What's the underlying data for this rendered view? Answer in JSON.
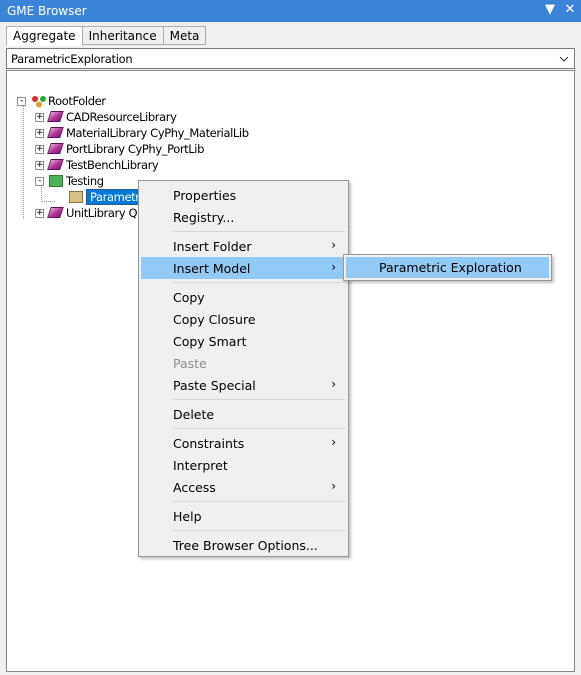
{
  "window": {
    "title": "GME Browser",
    "dropdown_icon": "dropdown-triangle-icon",
    "close_icon": "close-icon"
  },
  "tabs": [
    {
      "label": "Aggregate",
      "active": true
    },
    {
      "label": "Inheritance",
      "active": false
    },
    {
      "label": "Meta",
      "active": false
    }
  ],
  "combo": {
    "value": "ParametricExploration",
    "icon": "chevron-down-icon"
  },
  "tree": {
    "root": {
      "label": "RootFolder",
      "expander": "-"
    },
    "items": [
      {
        "label": "CADResourceLibrary",
        "expander": "+",
        "icon": "library-icon"
      },
      {
        "label": "MaterialLibrary CyPhy_MaterialLib",
        "expander": "+",
        "icon": "library-icon"
      },
      {
        "label": "PortLibrary CyPhy_PortLib",
        "expander": "+",
        "icon": "library-icon"
      },
      {
        "label": "TestBenchLibrary",
        "expander": "+",
        "icon": "library-icon"
      },
      {
        "label": "Testing",
        "expander": "-",
        "icon": "folder-icon"
      },
      {
        "label": "ParametricExploration",
        "icon": "folder-icon",
        "selected": true
      },
      {
        "label": "UnitLibrary QU",
        "expander": "+",
        "icon": "library-icon"
      }
    ]
  },
  "context_menu": {
    "items": [
      {
        "label": "Properties"
      },
      {
        "label": "Registry..."
      },
      {
        "label": "Insert Folder",
        "submenu": true
      },
      {
        "label": "Insert Model",
        "submenu": true,
        "highlighted": true
      },
      {
        "label": "Copy"
      },
      {
        "label": "Copy Closure"
      },
      {
        "label": "Copy Smart"
      },
      {
        "label": "Paste",
        "disabled": true
      },
      {
        "label": "Paste Special",
        "submenu": true
      },
      {
        "label": "Delete"
      },
      {
        "label": "Constraints",
        "submenu": true
      },
      {
        "label": "Interpret"
      },
      {
        "label": "Access",
        "submenu": true
      },
      {
        "label": "Help"
      },
      {
        "label": "Tree Browser Options..."
      }
    ],
    "submenu_arrow": "›"
  },
  "submenu": {
    "items": [
      {
        "label": "Parametric Exploration",
        "highlighted": true
      }
    ]
  },
  "colors": {
    "titlebar": "#3c84d8",
    "selection": "#0078d7",
    "menu_highlight": "#91c9f7"
  }
}
